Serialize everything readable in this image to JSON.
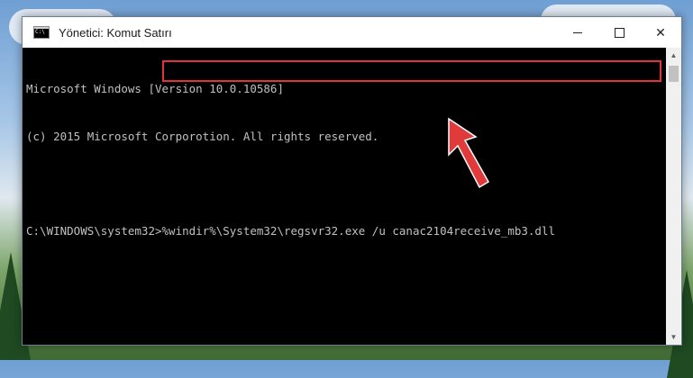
{
  "window": {
    "title": "Yönetici: Komut Satırı",
    "controls": {
      "minimize": "—",
      "maximize": "□",
      "close": "✕"
    }
  },
  "console": {
    "lines": [
      "Microsoft Windows [Version 10.0.10586]",
      "(c) 2015 Microsoft Corporotion. All rights reserved.",
      "",
      "C:\\WINDOWS\\system32>%windir%\\System32\\regsvr32.exe /u canac2104receive_mb3.dll"
    ]
  },
  "colors": {
    "highlight": "#e0343a",
    "arrow": "#e03a3a",
    "console_bg": "#000000",
    "console_text": "#c0c0c0"
  },
  "icons": {
    "app": "cmd-icon",
    "scroll_up": "chevron-up-icon",
    "scroll_down": "chevron-down-icon",
    "pointer": "red-arrow-icon"
  }
}
